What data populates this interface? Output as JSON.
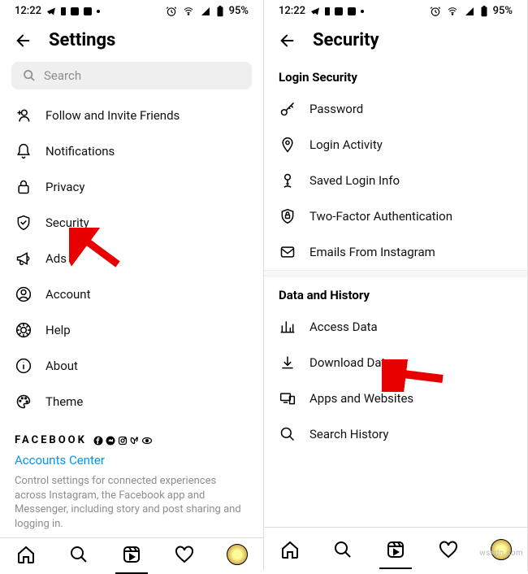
{
  "status": {
    "time": "12:22",
    "battery": "95%"
  },
  "left": {
    "title": "Settings",
    "search_placeholder": "Search",
    "items": [
      {
        "label": "Follow and Invite Friends"
      },
      {
        "label": "Notifications"
      },
      {
        "label": "Privacy"
      },
      {
        "label": "Security"
      },
      {
        "label": "Ads"
      },
      {
        "label": "Account"
      },
      {
        "label": "Help"
      },
      {
        "label": "About"
      },
      {
        "label": "Theme"
      }
    ],
    "brand": "FACEBOOK",
    "link": "Accounts Center",
    "desc": "Control settings for connected experiences across Instagram, the Facebook app and Messenger, including story and post sharing and logging in."
  },
  "right": {
    "title": "Security",
    "section1": "Login Security",
    "section1_items": [
      {
        "label": "Password"
      },
      {
        "label": "Login Activity"
      },
      {
        "label": "Saved Login Info"
      },
      {
        "label": "Two-Factor Authentication"
      },
      {
        "label": "Emails From Instagram"
      }
    ],
    "section2": "Data and History",
    "section2_items": [
      {
        "label": "Access Data"
      },
      {
        "label": "Download Data"
      },
      {
        "label": "Apps and Websites"
      },
      {
        "label": "Search History"
      }
    ]
  },
  "watermark": "wsxdn.com"
}
